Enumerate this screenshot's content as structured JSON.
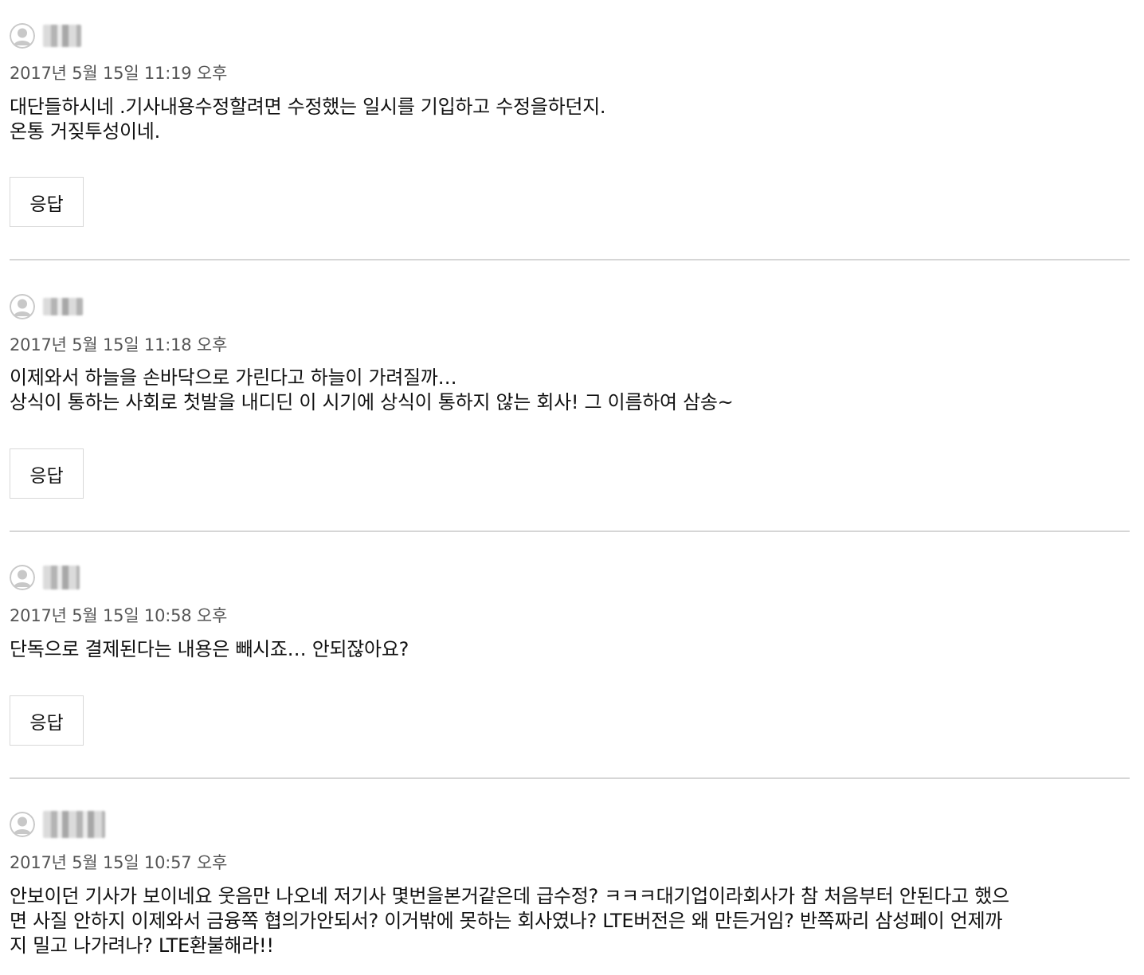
{
  "comments": [
    {
      "author": "",
      "date": "2017년 5월 15일 11:19 오후",
      "lines": [
        "대단들하시네 .기사내용수정할려면 수정했는 일시를 기입하고 수정을하던지.",
        "온통 거짖투성이네."
      ],
      "reply_label": "응답"
    },
    {
      "author": "",
      "date": "2017년 5월 15일 11:18 오후",
      "lines": [
        "이제와서 하늘을 손바닥으로 가린다고 하늘이 가려질까…",
        "상식이 통하는 사회로 첫발을 내디딘 이 시기에 상식이 통하지 않는 회사! 그 이름하여 삼송~"
      ],
      "reply_label": "응답"
    },
    {
      "author": "",
      "date": "2017년 5월 15일 10:58 오후",
      "lines": [
        "단독으로 결제된다는 내용은 빼시죠… 안되잖아요?"
      ],
      "reply_label": "응답"
    },
    {
      "author": "",
      "date": "2017년 5월 15일 10:57 오후",
      "lines": [
        "안보이던 기사가 보이네요 웃음만 나오네 저기사 몇번을본거같은데 급수정? ㅋㅋㅋ대기업이라회사가 참 처음부터 안된다고 했으",
        "면 사질 안하지 이제와서 금융쪽 협의가안되서? 이거밖에 못하는 회사였나? LTE버전은 왜 만든거임? 반쪽짜리 삼성페이 언제까",
        "지 밀고 나가려나? LTE환불해라!!"
      ]
    }
  ],
  "icons": {
    "avatar": "default-user-avatar-icon"
  },
  "colors": {
    "date_text": "#555555",
    "body_text": "#111111",
    "divider": "#d6d6d6",
    "button_border": "#d8d8d8",
    "avatar_gray": "#c8c8c8"
  }
}
